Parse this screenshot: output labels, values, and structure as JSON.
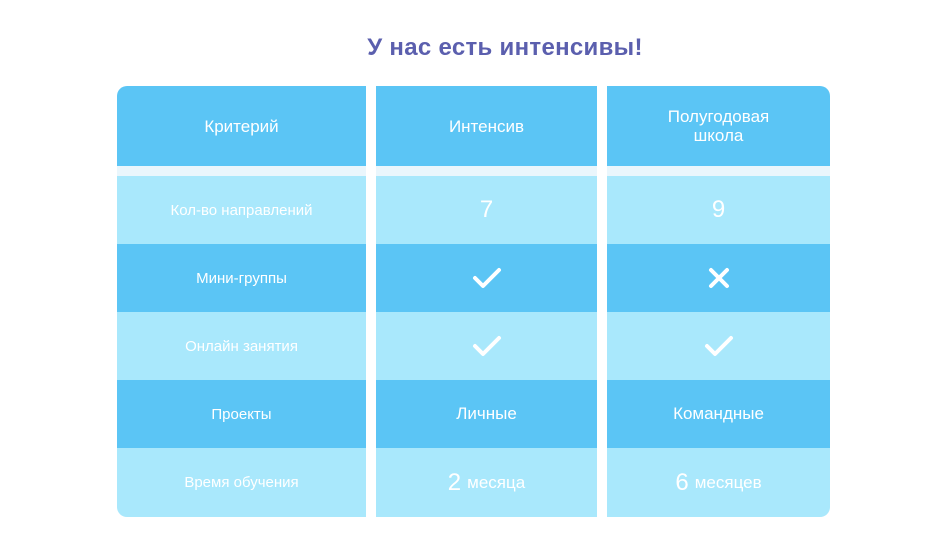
{
  "title": "У нас есть интенсивы!",
  "colors": {
    "title": "#5b5fae",
    "header": "#5bc5f5",
    "row_light": "#a9e8fc",
    "row_dark": "#5bc5f5",
    "text": "#ffffff"
  },
  "header": {
    "criterion": "Критерий",
    "intensive": "Интенсив",
    "school_line1": "Полугодовая",
    "school_line2": "школа"
  },
  "rows": [
    {
      "criterion": "Кол-во направлений",
      "intensive": "7",
      "school": "9"
    },
    {
      "criterion": "Мини-группы",
      "intensive_icon": "check-icon",
      "school_icon": "cross-icon"
    },
    {
      "criterion": "Онлайн занятия",
      "intensive_icon": "check-icon",
      "school_icon": "check-icon"
    },
    {
      "criterion": "Проекты",
      "intensive": "Личные",
      "school": "Командные"
    },
    {
      "criterion": "Время обучения",
      "intensive_num": "2",
      "intensive_unit": "месяца",
      "school_num": "6",
      "school_unit": "месяцев"
    }
  ]
}
